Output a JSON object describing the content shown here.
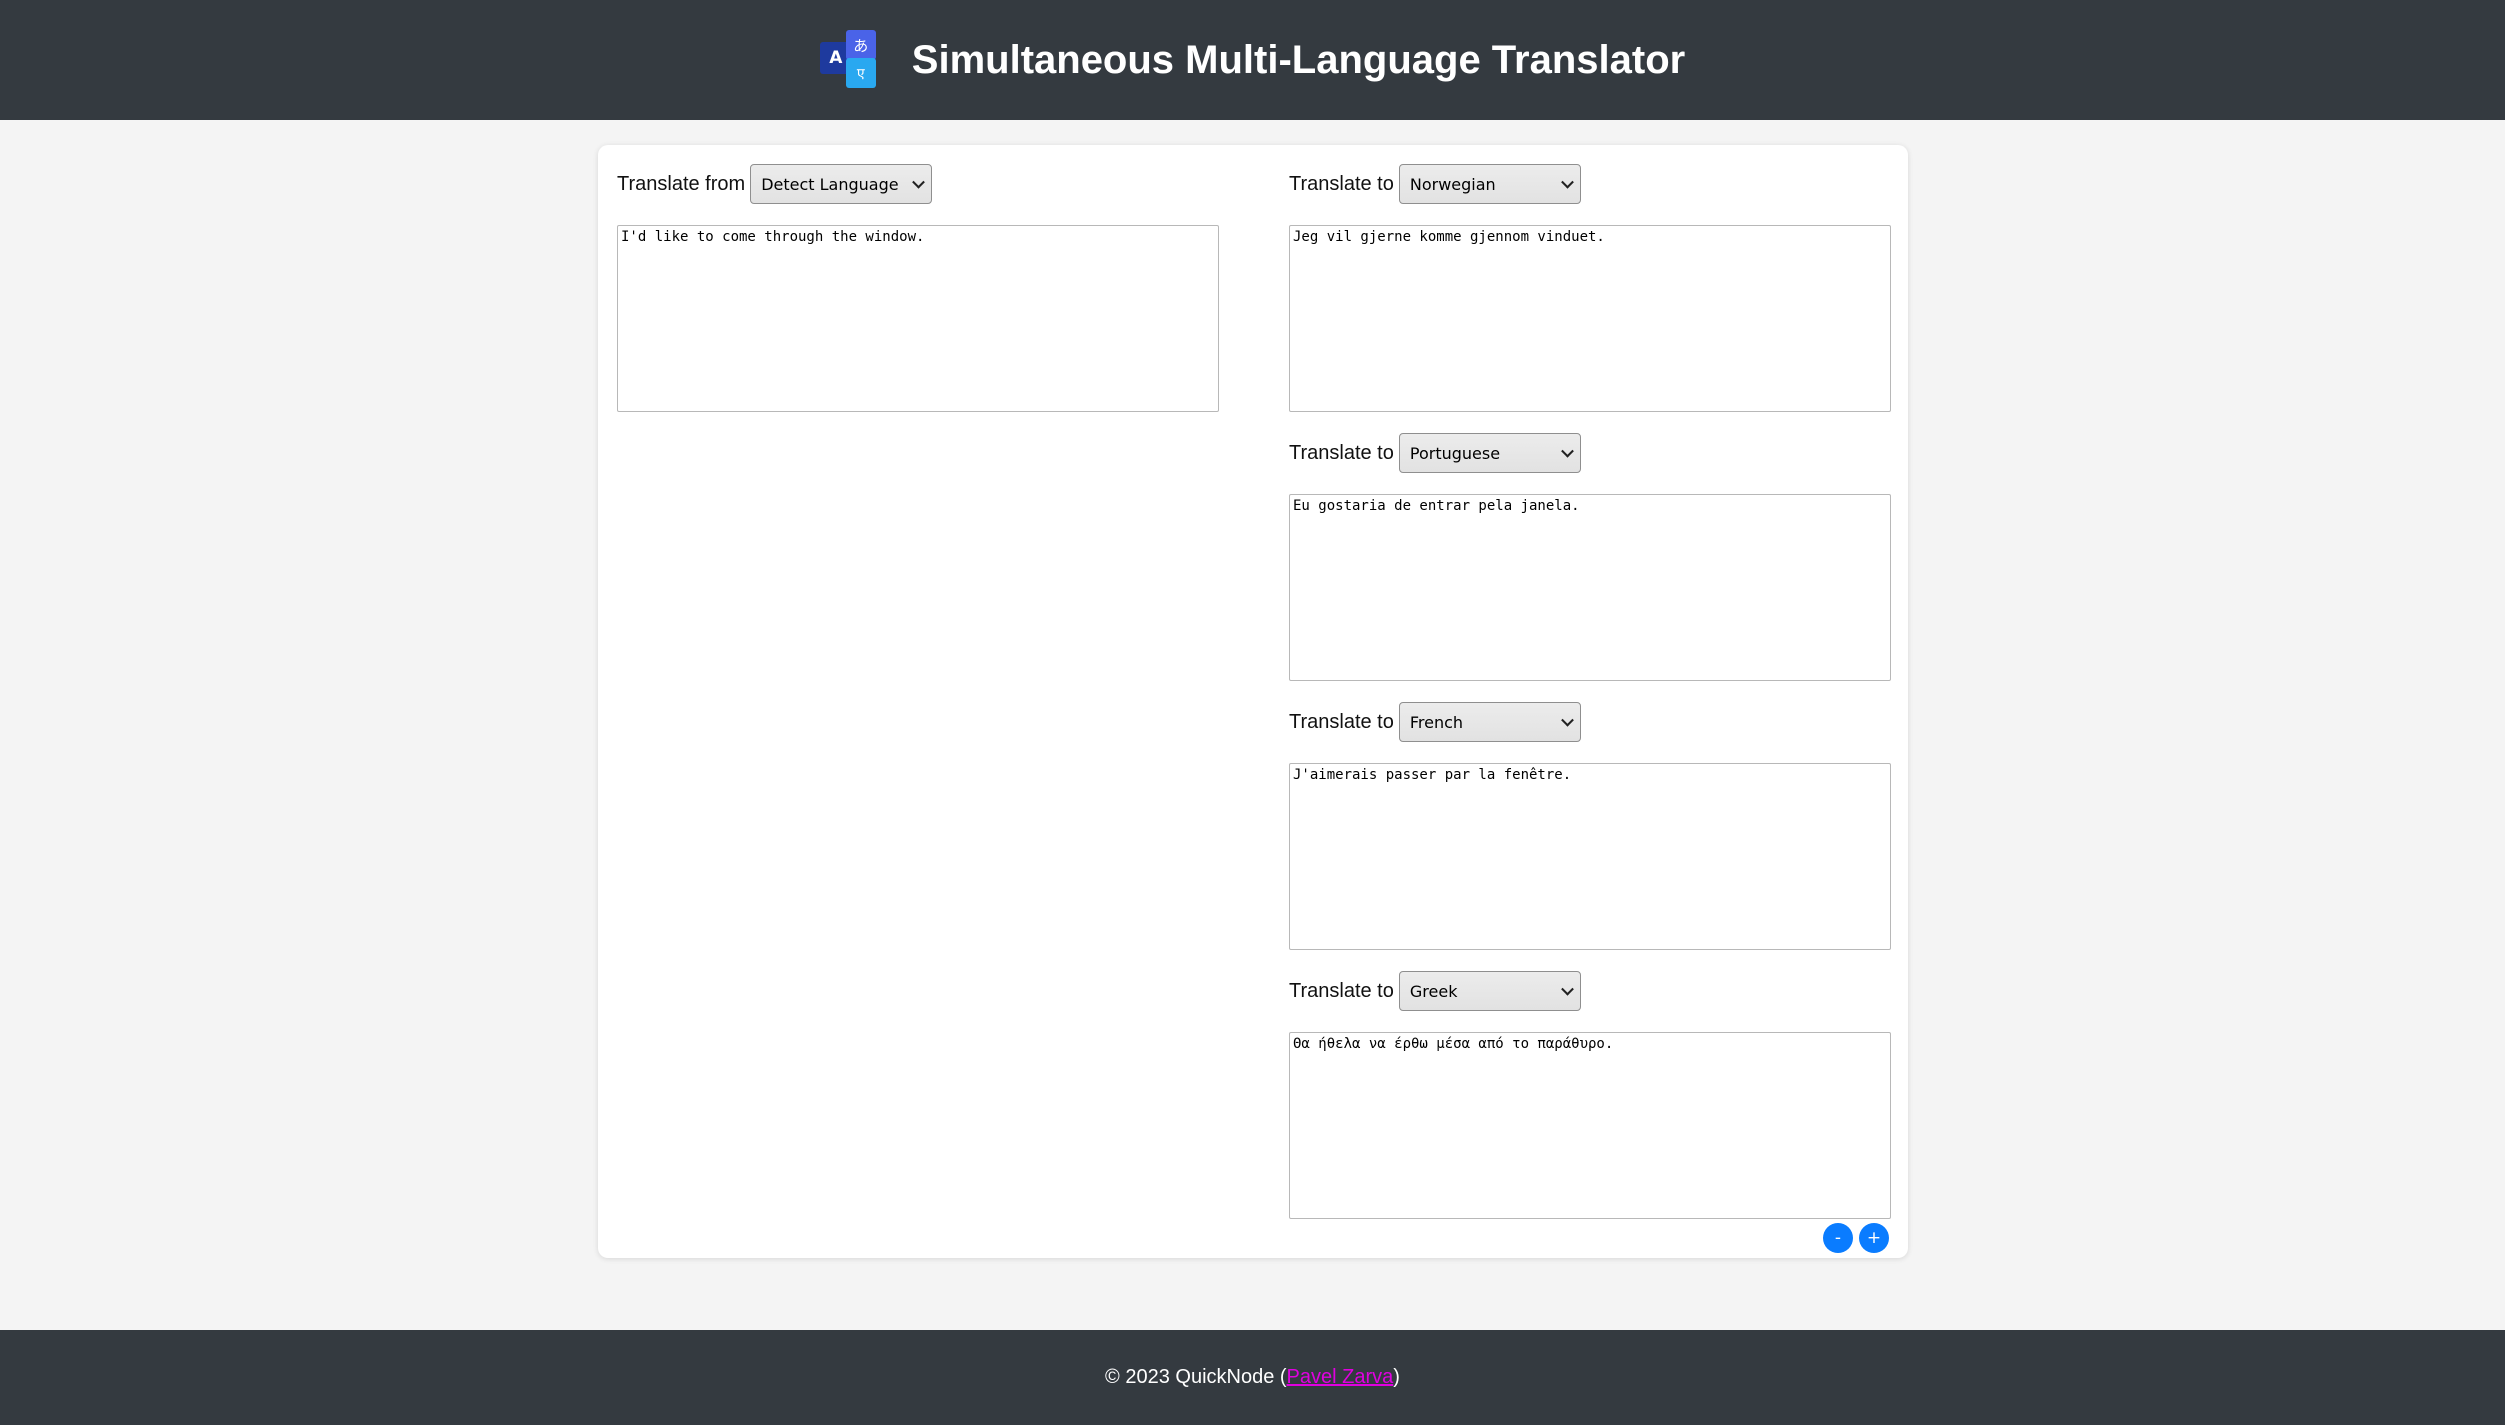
{
  "header": {
    "title": "Simultaneous Multi-Language Translator",
    "logo": {
      "icon": "translate-icon",
      "glyph_a": "A",
      "glyph_b": "あ",
      "glyph_c": "ए"
    }
  },
  "source": {
    "label": "Translate from",
    "selected_language": "Detect Language",
    "text": "I'd like to come through the window."
  },
  "targets": [
    {
      "label": "Translate to",
      "selected_language": "Norwegian",
      "text": "Jeg vil gjerne komme gjennom vinduet."
    },
    {
      "label": "Translate to",
      "selected_language": "Portuguese",
      "text": "Eu gostaria de entrar pela janela."
    },
    {
      "label": "Translate to",
      "selected_language": "French",
      "text": "J'aimerais passer par la fenêtre."
    },
    {
      "label": "Translate to",
      "selected_language": "Greek",
      "text": "Θα ήθελα να έρθω μέσα από το παράθυρο."
    }
  ],
  "controls": {
    "remove_label": "-",
    "add_label": "+"
  },
  "footer": {
    "prefix": "© 2023 QuickNode (",
    "author_link": "Pavel Zarva",
    "suffix": ")"
  },
  "colors": {
    "header_bg": "#343a40",
    "accent_button": "#0a7cff",
    "link": "#e000e0",
    "page_bg": "#f4f4f4"
  }
}
